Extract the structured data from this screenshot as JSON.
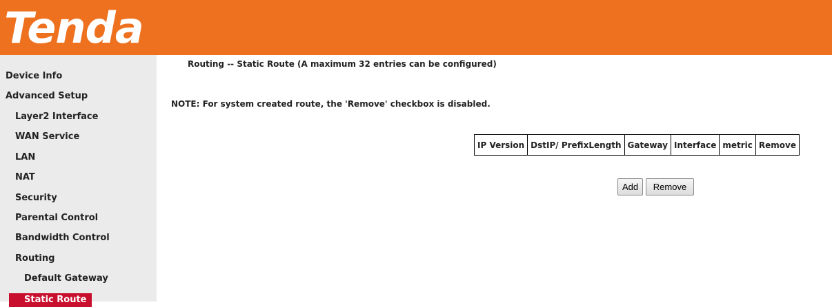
{
  "brand": {
    "logo_text": "Tenda",
    "header_color": "#EE7120"
  },
  "sidebar": {
    "items": [
      {
        "label": "Device Info"
      },
      {
        "label": "Advanced Setup"
      },
      {
        "label": "Layer2 Interface"
      },
      {
        "label": "WAN Service"
      },
      {
        "label": "LAN"
      },
      {
        "label": "NAT"
      },
      {
        "label": "Security"
      },
      {
        "label": "Parental Control"
      },
      {
        "label": "Bandwidth Control"
      },
      {
        "label": "Routing"
      },
      {
        "label": "Default Gateway"
      },
      {
        "label": "Static Route"
      }
    ],
    "active_color": "#C8102E"
  },
  "main": {
    "title": "Routing -- Static Route (A maximum 32 entries can be configured)",
    "note": "NOTE: For system created route, the 'Remove' checkbox is disabled.",
    "table": {
      "columns": [
        "IP Version",
        "DstIP/ PrefixLength",
        "Gateway",
        "Interface",
        "metric",
        "Remove"
      ]
    },
    "buttons": {
      "add": "Add",
      "remove": "Remove"
    }
  }
}
